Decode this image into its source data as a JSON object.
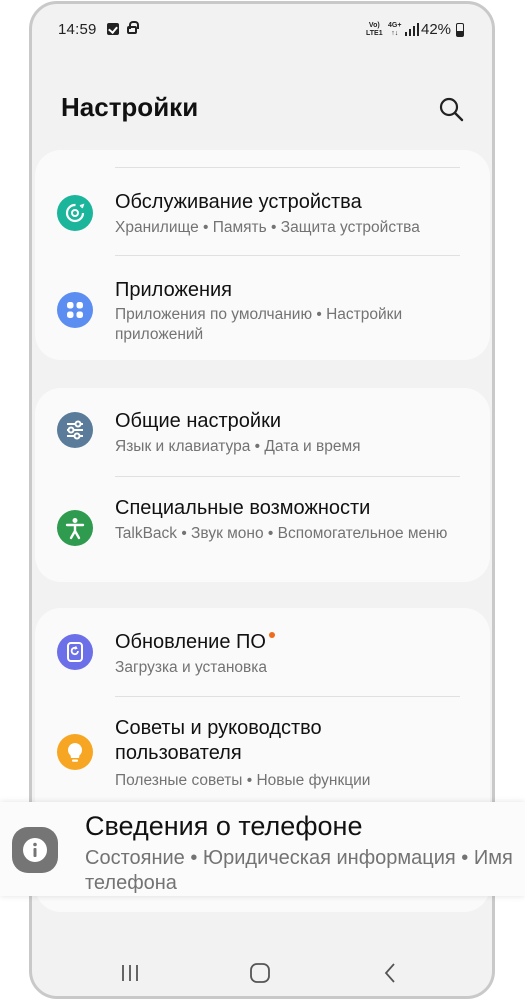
{
  "status_bar": {
    "time": "14:59",
    "volte_top": "Vo)",
    "volte_bottom": "LTE1",
    "network_top": "4G+",
    "network_bottom": "↑↓",
    "battery": "42%"
  },
  "header": {
    "title": "Настройки"
  },
  "groups": [
    {
      "items": [
        {
          "title": "Обслуживание устройства",
          "subtitle": "Хранилище • Память • Защита устройства",
          "icon": "device-care-icon",
          "icon_color": "#1bb59b"
        },
        {
          "title": "Приложения",
          "subtitle": "Приложения по умолчанию • Настройки приложений",
          "icon": "apps-icon",
          "icon_color": "#5c8ef2"
        }
      ]
    },
    {
      "items": [
        {
          "title": "Общие настройки",
          "subtitle": "Язык и клавиатура • Дата и время",
          "icon": "sliders-icon",
          "icon_color": "#5a7c9a"
        },
        {
          "title": "Специальные возможности",
          "subtitle": "TalkBack • Звук моно • Вспомогательное меню",
          "icon": "accessibility-icon",
          "icon_color": "#2e9b4f"
        }
      ]
    },
    {
      "items": [
        {
          "title": "Обновление ПО",
          "subtitle": "Загрузка и установка",
          "icon": "software-update-icon",
          "icon_color": "#6b6fe8",
          "badge_color": "#ef6c1a"
        },
        {
          "title": "Советы и руководство пользователя",
          "subtitle": "Полезные советы • Новые функции",
          "icon": "lightbulb-icon",
          "icon_color": "#f6a623"
        }
      ]
    }
  ],
  "highlighted_item": {
    "title": "Сведения о телефоне",
    "subtitle": "Состояние • Юридическая информация • Имя телефона",
    "icon": "info-icon",
    "icon_color": "#757575"
  },
  "nav_bar": {
    "recents": "recents-icon",
    "home": "home-icon",
    "back": "back-icon"
  }
}
